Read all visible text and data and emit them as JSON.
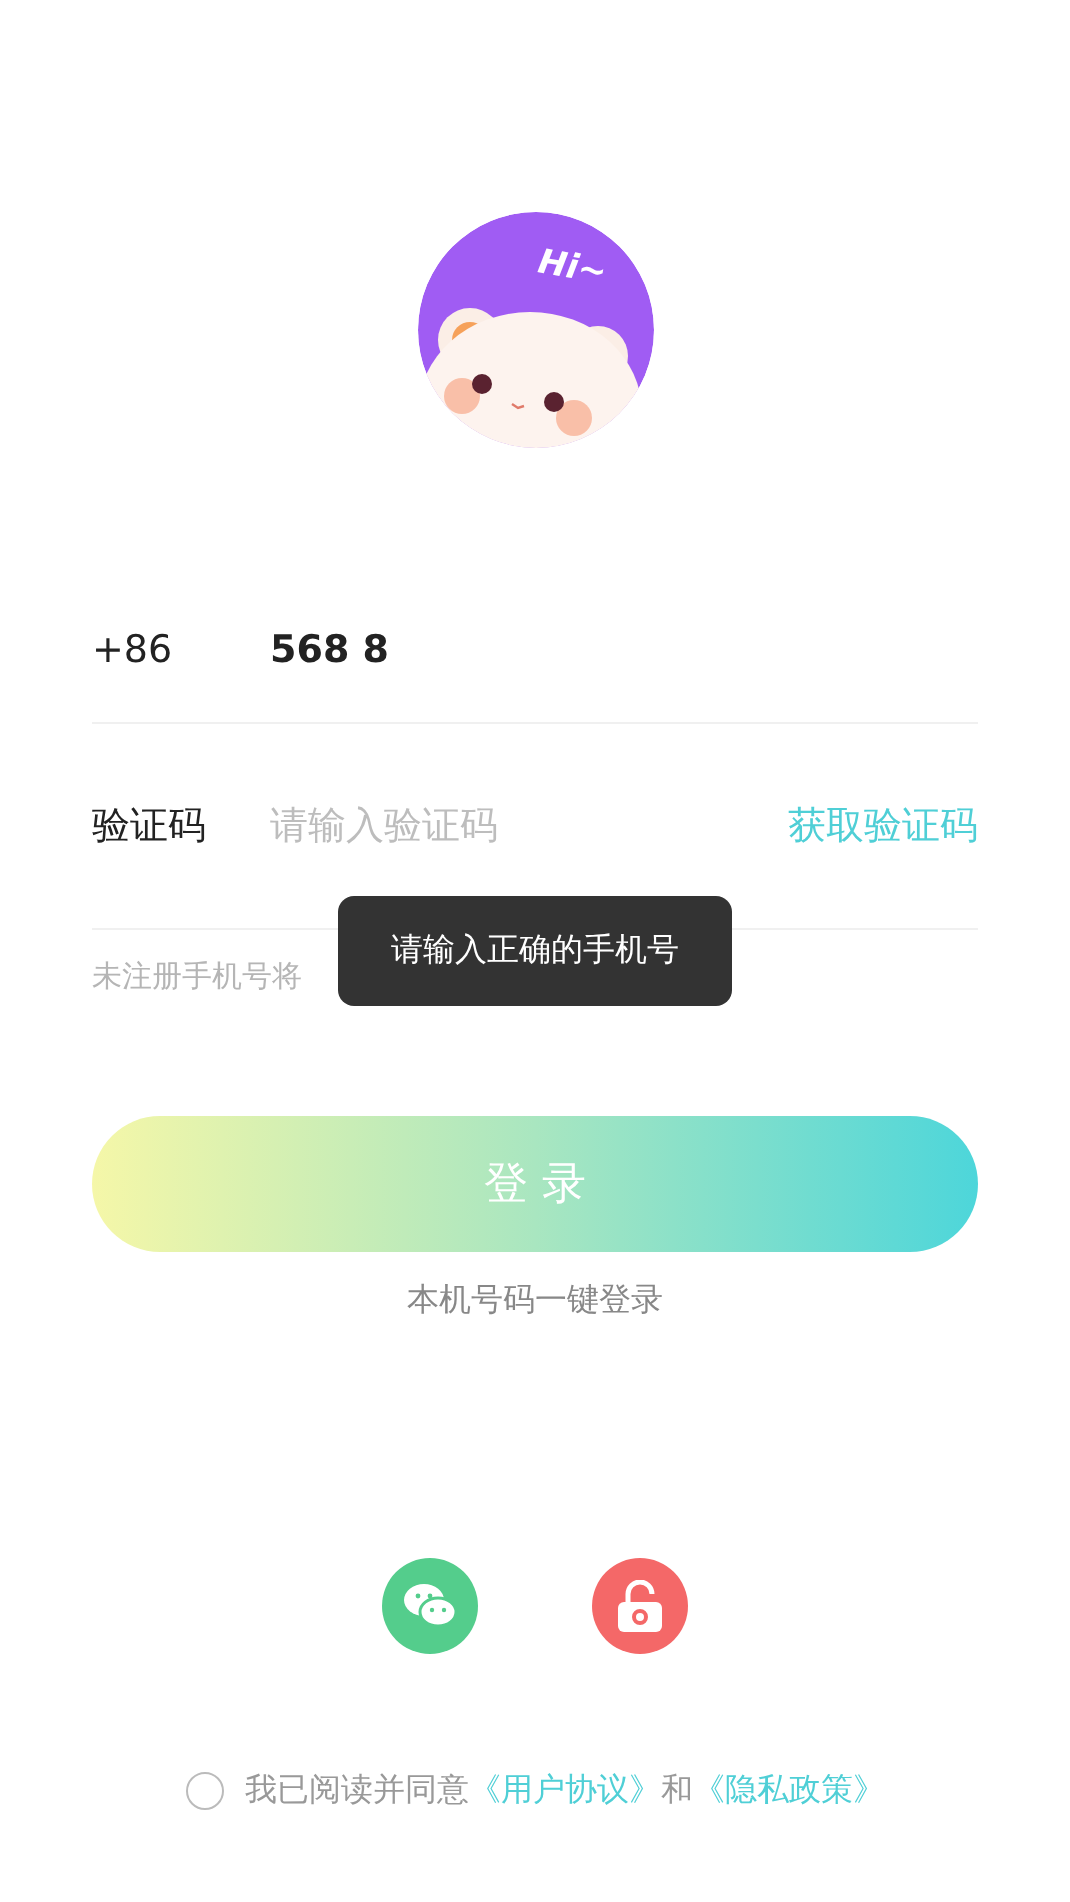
{
  "avatar": {
    "greeting": "Hi~"
  },
  "phone": {
    "country_code": "+86",
    "value": "568 8"
  },
  "code": {
    "label": "验证码",
    "placeholder": "请输入验证码",
    "get_code": "获取验证码"
  },
  "hint": "未注册手机号将",
  "toast": "请输入正确的手机号",
  "login_button": "登 录",
  "one_click": "本机号码一键登录",
  "social": [
    {
      "kind": "wechat"
    },
    {
      "kind": "lock"
    }
  ],
  "agreement": {
    "checked": false,
    "text": "我已阅读并同意",
    "links": [
      "《用户协议》",
      "《隐私政策》"
    ],
    "joiner": "和"
  }
}
